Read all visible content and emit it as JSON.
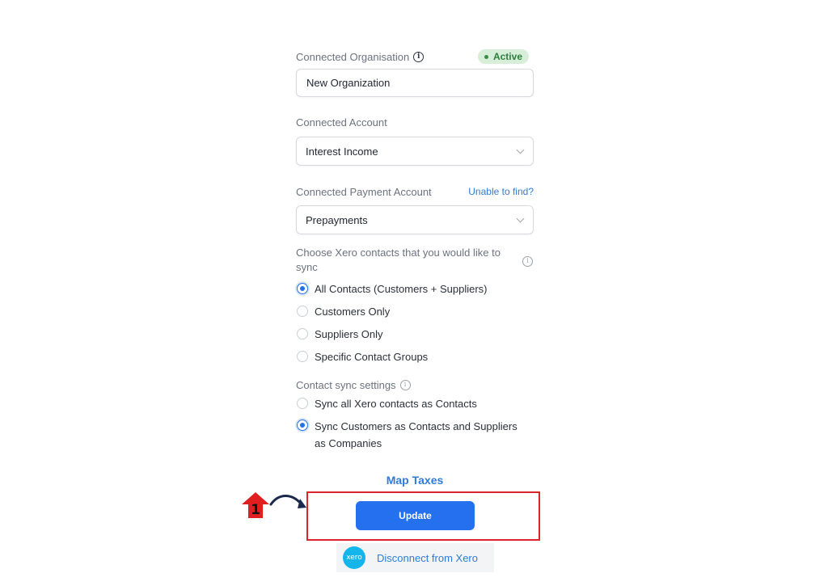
{
  "org": {
    "label": "Connected Organisation",
    "status": "Active",
    "value": "New Organization"
  },
  "account": {
    "label": "Connected Account",
    "value": "Interest Income"
  },
  "payment_account": {
    "label": "Connected Payment Account",
    "link": "Unable to find?",
    "value": "Prepayments"
  },
  "contacts": {
    "label": "Choose Xero contacts that you would like to sync",
    "options": [
      {
        "label": "All Contacts (Customers + Suppliers)",
        "selected": true
      },
      {
        "label": "Customers Only",
        "selected": false
      },
      {
        "label": "Suppliers Only",
        "selected": false
      },
      {
        "label": "Specific Contact Groups",
        "selected": false
      }
    ]
  },
  "sync_settings": {
    "label": "Contact sync settings",
    "options": [
      {
        "label": "Sync all Xero contacts as Contacts",
        "selected": false
      },
      {
        "label": "Sync Customers as Contacts and Suppliers as Companies",
        "selected": true
      }
    ]
  },
  "map_taxes": "Map Taxes",
  "update_label": "Update",
  "disconnect": {
    "logo_text": "xero",
    "label": "Disconnect from Xero"
  },
  "annotation": {
    "step_number": "1"
  },
  "colors": {
    "primary": "#2470ef",
    "link": "#2f7bd8",
    "active_badge_bg": "#d7efd9",
    "highlight_border": "#d8262a"
  }
}
